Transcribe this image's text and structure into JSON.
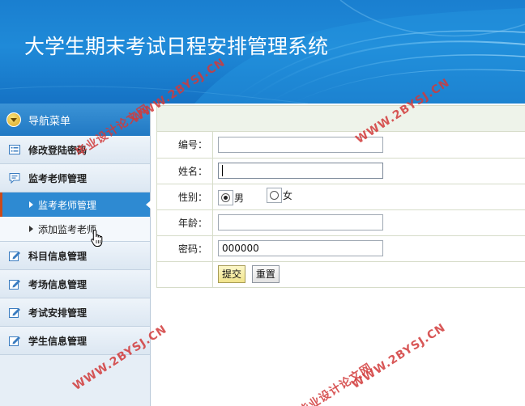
{
  "app": {
    "title": "大学生期末考试日程安排管理系统"
  },
  "sidebar": {
    "header_label": "导航菜单",
    "items": [
      {
        "label": "修改登陆密码",
        "icon": "list-icon"
      },
      {
        "label": "监考老师管理",
        "icon": "chat-icon"
      },
      {
        "label": "科目信息管理",
        "icon": "edit-icon"
      },
      {
        "label": "考场信息管理",
        "icon": "edit-icon"
      },
      {
        "label": "考试安排管理",
        "icon": "edit-icon"
      },
      {
        "label": "学生信息管理",
        "icon": "edit-icon"
      }
    ],
    "sub_items": [
      {
        "label": "监考老师管理",
        "active": true
      },
      {
        "label": "添加监考老师",
        "active": false
      }
    ]
  },
  "form": {
    "fields": {
      "id": {
        "label": "编号：",
        "value": ""
      },
      "name": {
        "label": "姓名：",
        "value": ""
      },
      "gender": {
        "label": "性别：",
        "options": [
          "男",
          "女"
        ],
        "selected": "男"
      },
      "age": {
        "label": "年龄：",
        "value": ""
      },
      "password": {
        "label": "密码：",
        "value": "000000"
      }
    },
    "submit_label": "提交",
    "reset_label": "重置"
  },
  "watermarks": {
    "site": "WWW.2BYSJ.CN",
    "site_cn": "毕业设计论文网"
  },
  "colors": {
    "header_blue": "#1a7fd0",
    "active_menu": "#2e8ad2",
    "watermark_red": "#d23a3a"
  }
}
